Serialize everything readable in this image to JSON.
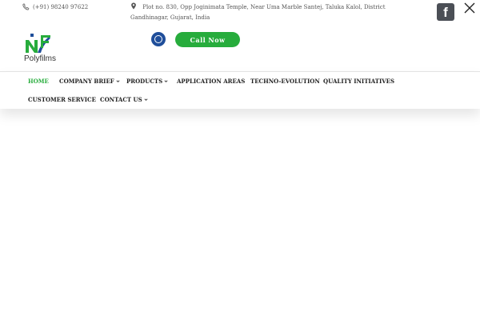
{
  "header": {
    "phone": "(+91) 98240 97622",
    "address": "Plot no. 830, Opp Joginimata Temple, Near Uma Marble Santej, Taluka Kalol, District Gandhinagar, Gujarat, India",
    "call_button": "Call Now"
  },
  "logo": {
    "text": "Polyfilms"
  },
  "nav": {
    "row1": [
      {
        "label": "HOME",
        "active": true,
        "dropdown": false
      },
      {
        "label": "COMPANY BRIEF",
        "active": false,
        "dropdown": true
      },
      {
        "label": "PRODUCTS",
        "active": false,
        "dropdown": true
      },
      {
        "label": "APPLICATION AREAS",
        "active": false,
        "dropdown": false
      },
      {
        "label": "TECHNO-EVOLUTION",
        "active": false,
        "dropdown": false
      },
      {
        "label": "QUALITY INITIATIVES",
        "active": false,
        "dropdown": false
      }
    ],
    "row2": [
      {
        "label": "CUSTOMER SERVICE",
        "active": false,
        "dropdown": false
      },
      {
        "label": "CONTACT US",
        "active": false,
        "dropdown": true
      }
    ]
  },
  "colors": {
    "accent_green": "#27ac3c",
    "logo_blue": "#1f4e9a",
    "facebook_grey": "#4b4f56"
  },
  "icons": [
    "phone-icon",
    "map-pin-icon",
    "search-icon",
    "facebook-icon",
    "close-icon",
    "chevron-down-icon"
  ]
}
